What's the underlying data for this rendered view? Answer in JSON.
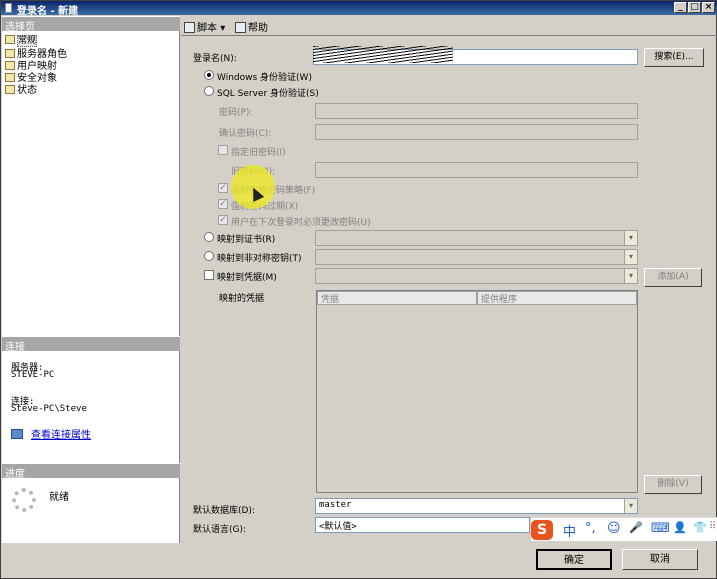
{
  "window": {
    "title": "登录名 - 新建",
    "minimize": "_",
    "maximize": "□",
    "close": "×"
  },
  "left": {
    "select_page_header": "选择页",
    "pages": [
      "常规",
      "服务器角色",
      "用户映射",
      "安全对象",
      "状态"
    ],
    "connection_header": "连接",
    "server_label": "服务器:",
    "server_value": "STEVE-PC",
    "connection_label": "连接:",
    "connection_value": "Steve-PC\\Steve",
    "view_connection_link": "查看连接属性",
    "progress_header": "进度",
    "progress_status": "就绪"
  },
  "toolbar": {
    "script_label": "脚本",
    "script_arrow": "▾",
    "help_label": "帮助"
  },
  "form": {
    "login_name_label": "登录名(N):",
    "login_name_value": "",
    "search_button": "搜索(E)...",
    "windows_auth_label": "Windows 身份验证(W)",
    "sql_auth_label": "SQL Server 身份验证(S)",
    "password_label": "密码(P):",
    "confirm_password_label": "确认密码(C):",
    "specify_old_password_label": "指定旧密码(I)",
    "old_password_label": "旧密码(O):",
    "enforce_policy_label": "强制实施密码策略(F)",
    "enforce_expiration_label": "强制密码过期(X)",
    "must_change_label": "用户在下次登录时必须更改密码(U)",
    "checked_mark": "✓",
    "map_certificate_label": "映射到证书(R)",
    "map_asym_key_label": "映射到非对称密钥(T)",
    "map_credential_label": "映射到凭据(M)",
    "add_button": "添加(A)",
    "mapped_credentials_label": "映射的凭据",
    "grid_col_credential": "凭据",
    "grid_col_provider": "提供程序",
    "remove_button": "删除(V)",
    "default_db_label": "默认数据库(D):",
    "default_db_value": "master",
    "default_lang_label": "默认语言(G):",
    "default_lang_value": "<默认值>",
    "combo_arrow": "▾"
  },
  "footer": {
    "ok_button": "确定",
    "cancel_button": "取消"
  },
  "ime": {
    "logo": "S",
    "chinese": "中",
    "punct": "°,",
    "emoji": "☺",
    "mic": "🎤",
    "keyboard": "⌨",
    "user": "👤",
    "shirt": "👕",
    "grid": "⠿"
  }
}
